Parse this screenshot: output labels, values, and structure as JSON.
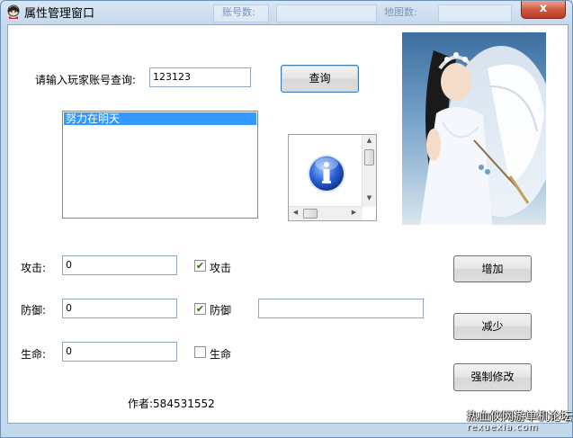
{
  "window": {
    "title": "属性管理窗口",
    "close_glyph": "x",
    "background_ghost_labels": [
      "账号数:",
      "地图数:"
    ]
  },
  "query": {
    "label": "请输入玩家账号查询:",
    "input_value": "123123",
    "button_label": "查询"
  },
  "list": {
    "items": [
      "努力在明天"
    ]
  },
  "info_icon": {
    "icon": "info-icon",
    "glyph": "i",
    "color": "#1e56c4"
  },
  "photo": {
    "icon": "character-portrait-image"
  },
  "fields": {
    "attack": {
      "label": "攻击:",
      "value": "0",
      "checkbox_label": "攻击",
      "checked": true
    },
    "defense": {
      "label": "防御:",
      "value": "0",
      "checkbox_label": "防御",
      "checked": true,
      "extra_value": ""
    },
    "life": {
      "label": "生命:",
      "value": "0",
      "checkbox_label": "生命",
      "checked": false
    }
  },
  "buttons": {
    "increase": "增加",
    "decrease": "减少",
    "force_modify": "强制修改"
  },
  "author": "作者:584531552",
  "watermark": {
    "line1": "热血侠网游单机论坛",
    "line2": "rexuexia.com"
  }
}
